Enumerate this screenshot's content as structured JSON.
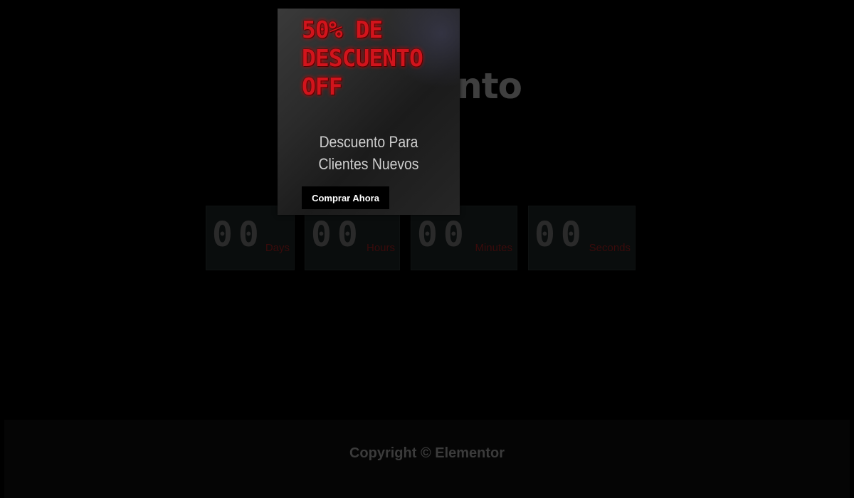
{
  "background": {
    "title": "5         scuento",
    "countdown": [
      {
        "digits": "00",
        "label": "Days"
      },
      {
        "digits": "00",
        "label": "Hours"
      },
      {
        "digits": "00",
        "label": "Minutes"
      },
      {
        "digits": "00",
        "label": "Seconds"
      }
    ],
    "copyright": "Copyright © Elementor"
  },
  "popup": {
    "promo_lines": [
      "50% DE",
      "DESCUENTO",
      "OFF"
    ],
    "subtitle_lines": [
      "Descuento Para",
      "Clientes Nuevos"
    ],
    "cta_label": "Comprar Ahora"
  },
  "colors": {
    "promo_red": "#d1141c",
    "overlay": "#000000"
  }
}
